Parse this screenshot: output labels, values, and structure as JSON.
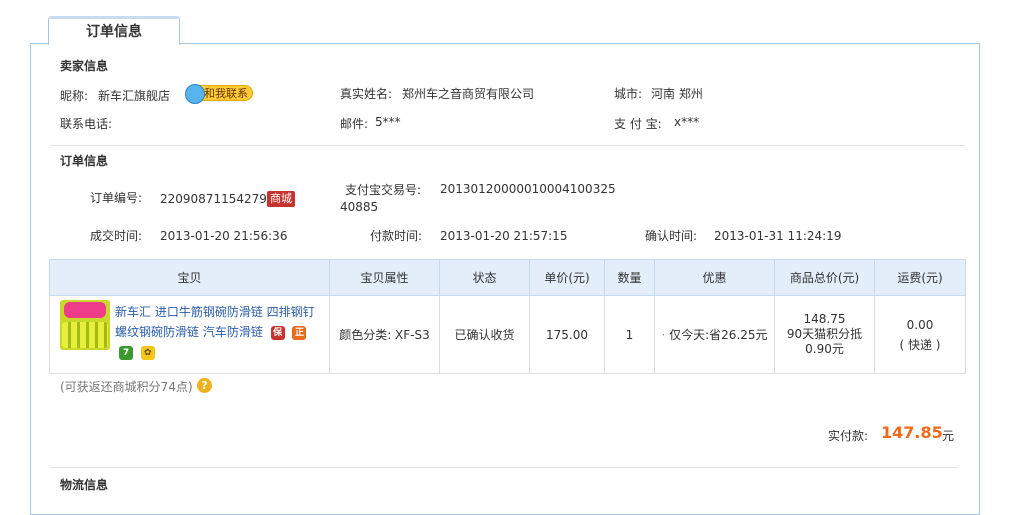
{
  "tab": {
    "title": "订单信息"
  },
  "seller": {
    "section_title": "卖家信息",
    "nickname_label": "昵称:",
    "nickname": "新车汇旗舰店",
    "contact_button": "和我联系",
    "realname_label": "真实姓名:",
    "realname": "郑州车之音商贸有限公司",
    "city_label": "城市:",
    "city": "河南 郑州",
    "phone_label": "联系电话:",
    "email_label": "邮件:",
    "email": "5***",
    "alipay_label": "支 付 宝:",
    "alipay": "x***"
  },
  "order": {
    "section_title": "订单信息",
    "order_no_label": "订单编号:",
    "order_no": "220908711542791",
    "mall_badge": "商城",
    "trade_no_label": "支付宝交易号:",
    "trade_no_line1": "20130120000010004100325",
    "trade_no_line2": "40885",
    "deal_time_label": "成交时间:",
    "deal_time": "2013-01-20 21:56:36",
    "pay_time_label": "付款时间:",
    "pay_time": "2013-01-20 21:57:15",
    "confirm_time_label": "确认时间:",
    "confirm_time": "2013-01-31 11:24:19"
  },
  "goods_table": {
    "headers": [
      "宝贝",
      "宝贝属性",
      "状态",
      "单价(元)",
      "数量",
      "优惠",
      "商品总价(元)",
      "运费(元)"
    ],
    "row": {
      "title": "新车汇 进口牛筋钢碗防滑链 四排钢钉螺纹钢碗防滑链 汽车防滑链",
      "attribute": "颜色分类: XF-S3",
      "status": "已确认收货",
      "unit_price": "175.00",
      "quantity": "1",
      "discount": "仅今天:省26.25元",
      "total_line1": "148.75",
      "total_line2": "90天猫积分抵",
      "total_line3": "0.90元",
      "shipping": "0.00",
      "shipping_method": "( 快递 )"
    },
    "icons": [
      "bao-icon",
      "certified-icon",
      "seven-day-return-icon",
      "flower-icon"
    ]
  },
  "points_note": "(可获返还商城积分74点)",
  "payment": {
    "label": "实付款:",
    "amount": "147.85",
    "unit": "元"
  },
  "logistics": {
    "section_title": "物流信息"
  }
}
